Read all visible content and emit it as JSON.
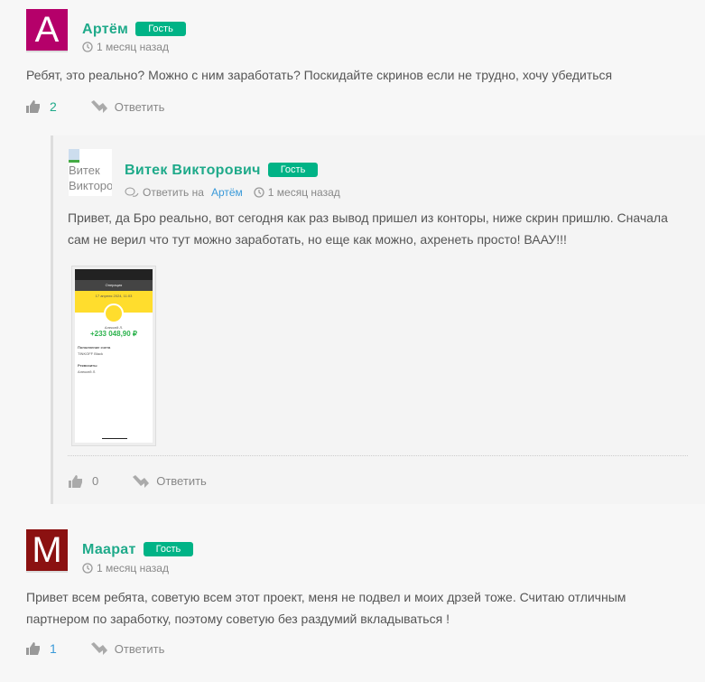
{
  "badge_label": "Гость",
  "reply_label": "Ответить",
  "colors": {
    "accent": "#1faa8a",
    "badge": "#00b386",
    "link": "#3a9ad9"
  },
  "comments": [
    {
      "avatar_letter": "A",
      "avatar_color": "#b5006a",
      "author": "Артём",
      "time": "1 месяц назад",
      "text": "Ребят, это реально? Можно с ним заработать? Поскидайте скринов если не трудно, хочу убедиться",
      "likes": "2"
    },
    {
      "avatar_alt": "Витек Викторович",
      "author": "Витек Викторович",
      "reply_to_label": "Ответить на",
      "reply_to": "Артём",
      "time": "1 месяц назад",
      "text": "Привет, да Бро реально, вот сегодня как раз вывод пришел из конторы, ниже скрин пришлю. Сначала сам не верил что тут можно заработать, но еще как можно, ахренеть просто! ВААУ!!!",
      "likes": "0",
      "screenshot": {
        "header": "Операция",
        "date": "17 апреля 2024, 11:03",
        "sender": "Алексей Л.",
        "amount": "+233 048,90 ₽",
        "section": "Пополнение счета",
        "card": "TINKOFF Black",
        "details": "Реквизиты",
        "recipient": "Алексей Л."
      }
    },
    {
      "avatar_letter": "M",
      "avatar_color": "#8b1111",
      "author": "Маарат",
      "time": "1 месяц назад",
      "text": "Привет всем ребята, советую всем этот проект, меня не подвел и моих дрзей тоже. Считаю отличным партнером по заработку, поэтому советую без раздумий вкладываться !",
      "likes": "1"
    }
  ]
}
